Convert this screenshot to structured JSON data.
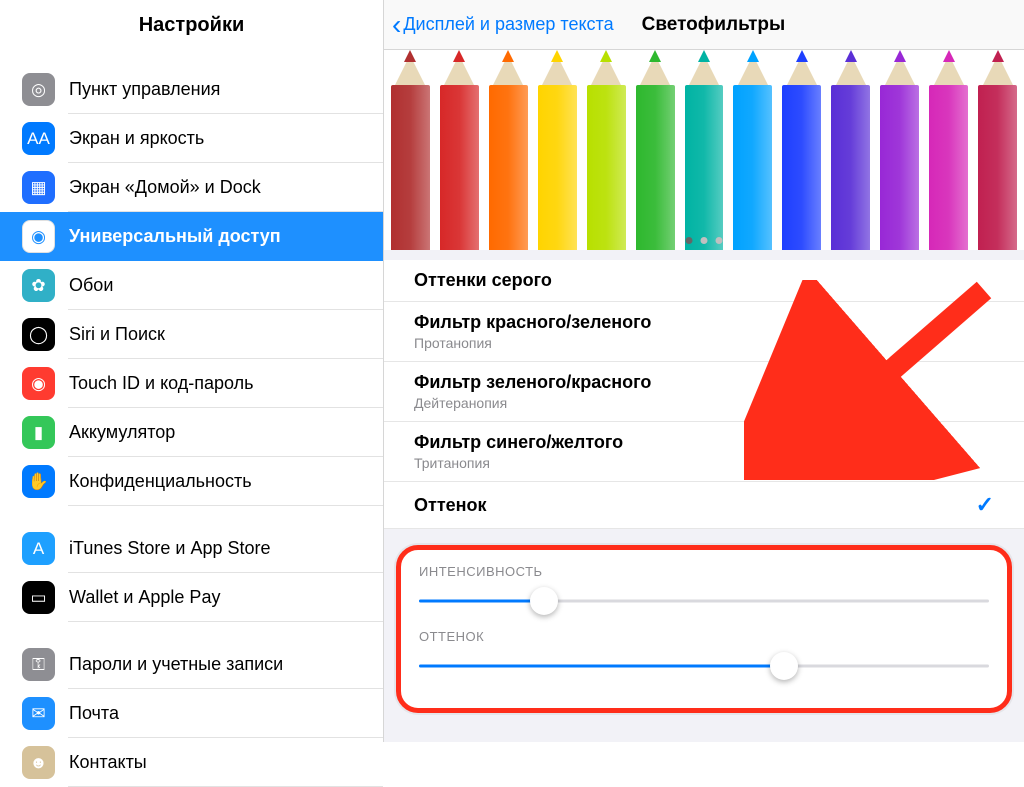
{
  "sidebar": {
    "title": "Настройки",
    "groups": [
      {
        "items": [
          {
            "icon": "control-center-icon",
            "cls": "ic-gray",
            "glyph": "◎",
            "label": "Пункт управления"
          },
          {
            "icon": "display-icon",
            "cls": "ic-blue",
            "glyph": "AA",
            "label": "Экран и яркость"
          },
          {
            "icon": "home-dock-icon",
            "cls": "ic-blue2",
            "glyph": "▦",
            "label": "Экран «Домой» и Dock"
          },
          {
            "icon": "accessibility-icon",
            "cls": "ic-white",
            "glyph": "◉",
            "label": "Универсальный доступ",
            "selected": true
          },
          {
            "icon": "wallpaper-icon",
            "cls": "ic-teal",
            "glyph": "✿",
            "label": "Обои"
          },
          {
            "icon": "siri-icon",
            "cls": "ic-black",
            "glyph": "◯",
            "label": "Siri и Поиск"
          },
          {
            "icon": "touchid-icon",
            "cls": "ic-red",
            "glyph": "◉",
            "label": "Touch ID и код-пароль"
          },
          {
            "icon": "battery-icon",
            "cls": "ic-green",
            "glyph": "▮",
            "label": "Аккумулятор"
          },
          {
            "icon": "privacy-icon",
            "cls": "ic-bluehand",
            "glyph": "✋",
            "label": "Конфиденциальность"
          }
        ]
      },
      {
        "items": [
          {
            "icon": "appstore-icon",
            "cls": "ic-blueapp",
            "glyph": "A",
            "label": "iTunes Store и App Store"
          },
          {
            "icon": "wallet-icon",
            "cls": "ic-wallet",
            "glyph": "▭",
            "label": "Wallet и Apple Pay"
          }
        ]
      },
      {
        "items": [
          {
            "icon": "key-icon",
            "cls": "ic-key",
            "glyph": "⚿",
            "label": "Пароли и учетные записи"
          },
          {
            "icon": "mail-icon",
            "cls": "ic-mail",
            "glyph": "✉",
            "label": "Почта"
          },
          {
            "icon": "contacts-icon",
            "cls": "ic-contacts",
            "glyph": "☻",
            "label": "Контакты"
          }
        ]
      }
    ]
  },
  "main": {
    "back_label": "Дисплей и размер текста",
    "title": "Светофильтры",
    "pencil_colors": [
      "#b03030",
      "#d72828",
      "#ff6a00",
      "#ffd400",
      "#b8e000",
      "#2eb82e",
      "#00b3a3",
      "#00a2ff",
      "#1e3fff",
      "#5a2fd6",
      "#9828d6",
      "#d628b8",
      "#c02050"
    ],
    "filters": [
      {
        "title": "Оттенки серого"
      },
      {
        "title": "Фильтр красного/зеленого",
        "sub": "Протанопия"
      },
      {
        "title": "Фильтр зеленого/красного",
        "sub": "Дейтеранопия"
      },
      {
        "title": "Фильтр синего/желтого",
        "sub": "Тританопия"
      },
      {
        "title": "Оттенок",
        "checked": true
      }
    ],
    "sliders": {
      "intensity": {
        "label": "ИНТЕНСИВНОСТЬ",
        "value": 22
      },
      "hue": {
        "label": "ОТТЕНОК",
        "value": 64
      }
    }
  }
}
